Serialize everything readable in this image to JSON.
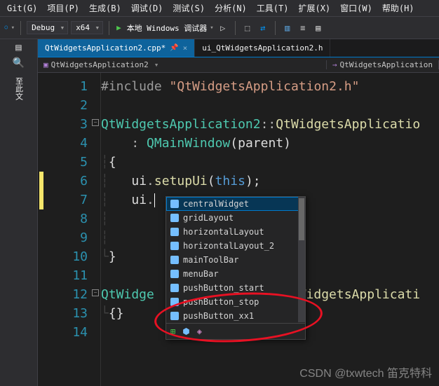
{
  "menubar": {
    "items": [
      "Git(G)",
      "项目(P)",
      "生成(B)",
      "调试(D)",
      "测试(S)",
      "分析(N)",
      "工具(T)",
      "扩展(X)",
      "窗口(W)",
      "帮助(H)"
    ]
  },
  "toolbar": {
    "config": "Debug",
    "platform": "x64",
    "run_label": "本地 Windows 调试器"
  },
  "tabs": {
    "active": "QtWidgetsApplication2.cpp*",
    "inactive": "ui_QtWidgetsApplication2.h"
  },
  "navbar": {
    "scope": "QtWidgetsApplication2",
    "member": "QtWidgetsApplication"
  },
  "side_tool": "至此文",
  "watermark": "CSDN @txwtech 笛克特科",
  "lines": [
    "1",
    "2",
    "3",
    "4",
    "5",
    "6",
    "7",
    "8",
    "9",
    "10",
    "11",
    "12",
    "13",
    "14"
  ],
  "code": {
    "l1_pp": "#include ",
    "l1_str": "\"QtWidgetsApplication2.h\"",
    "l3_type": "QtWidgetsApplication2",
    "l3_ctor": "QtWidgetsApplicatio",
    "l4_base": "QMainWindow",
    "l4_arg": "parent",
    "l6_obj": "ui",
    "l6_fn": "setupUi",
    "l6_this": "this",
    "l7_obj": "ui",
    "l12_type": "QtWidge",
    "l12_rest": "tWidgetsApplicati"
  },
  "intellisense": {
    "items": [
      "centralWidget",
      "gridLayout",
      "horizontalLayout",
      "horizontalLayout_2",
      "mainToolBar",
      "menuBar",
      "pushButton_start",
      "pushButton_stop",
      "pushButton_xx1"
    ],
    "selected": 0
  }
}
